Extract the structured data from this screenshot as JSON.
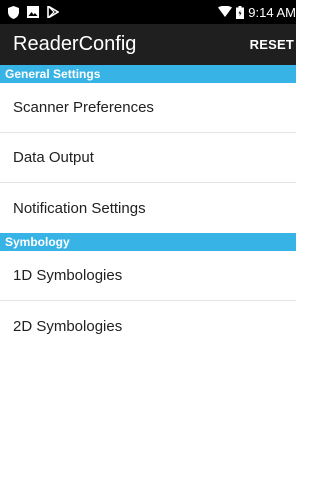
{
  "status_bar": {
    "time": "9:14 AM",
    "left_icons": [
      "shield-icon",
      "image-icon",
      "play-store-icon"
    ],
    "right_icons": [
      "wifi-icon",
      "battery-icon"
    ]
  },
  "app_bar": {
    "title": "ReaderConfig",
    "action_label": "RESET"
  },
  "sections": [
    {
      "header": "General Settings",
      "items": [
        "Scanner Preferences",
        "Data Output",
        "Notification Settings"
      ]
    },
    {
      "header": "Symbology",
      "items": [
        "1D Symbologies",
        "2D Symbologies"
      ]
    }
  ],
  "colors": {
    "status_bar": "#000000",
    "app_bar": "#1f1f1f",
    "section_header": "#37b3e6",
    "text": "#212121",
    "divider": "#e4e4e4"
  }
}
